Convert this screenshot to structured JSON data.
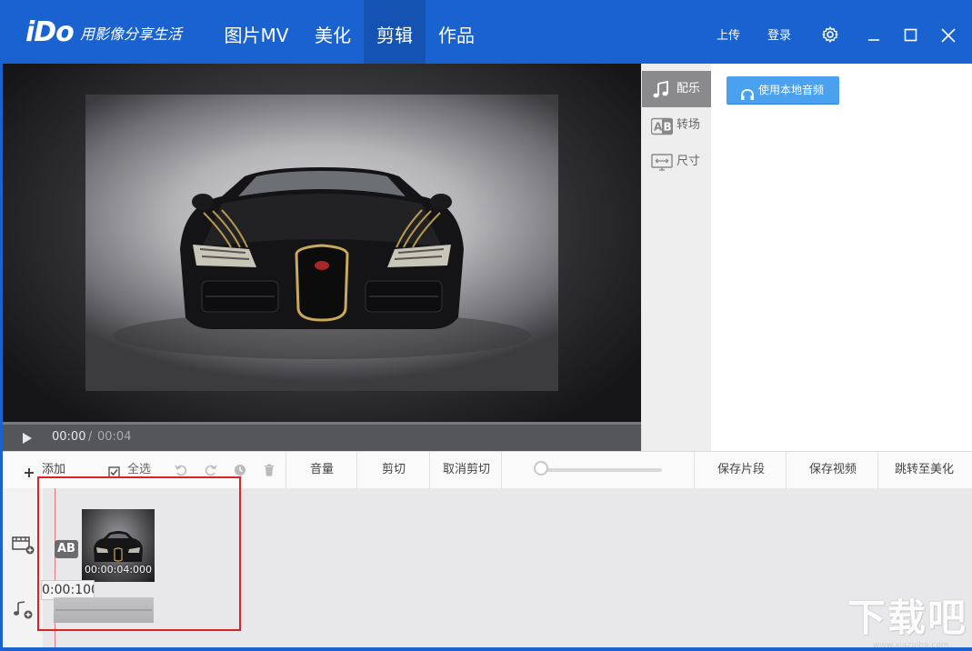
{
  "header": {
    "logo": "iDo",
    "slogan": "用影像分享生活",
    "tabs": [
      {
        "label": "图片MV",
        "active": false
      },
      {
        "label": "美化",
        "active": false
      },
      {
        "label": "剪辑",
        "active": true
      },
      {
        "label": "作品",
        "active": false
      }
    ],
    "upload_label": "上传",
    "login_label": "登录",
    "icons": [
      "gear-icon",
      "minimize-icon",
      "maximize-icon",
      "close-icon"
    ]
  },
  "player": {
    "current_time": "00:00",
    "separator": "/",
    "total_time": "00:04",
    "progress": 0.0
  },
  "side_tabs": [
    {
      "label": "配乐",
      "icon": "music-note-icon",
      "active": true
    },
    {
      "label": "转场",
      "icon": "transition-ab-icon",
      "active": false
    },
    {
      "label": "尺寸",
      "icon": "monitor-size-icon",
      "active": false
    }
  ],
  "music_panel": {
    "local_audio_button": "使用本地音频",
    "icon": "headphones-icon"
  },
  "toolbar": {
    "add_label": "添加",
    "select_all_label": "全选",
    "volume_label": "音量",
    "cut_label": "剪切",
    "cancel_cut_label": "取消剪切",
    "save_segment_label": "保存片段",
    "save_video_label": "保存视频",
    "goto_beautify_label": "跳转至美化",
    "zoom_level": 0.0,
    "icons": [
      "plus-icon",
      "checkbox-icon",
      "undo-icon",
      "redo-icon",
      "clock-icon",
      "trash-icon"
    ]
  },
  "timeline": {
    "transition_badge": "AB",
    "clip_duration": "00:00:04:000",
    "playhead_tooltip": "0:00:100",
    "icons": [
      "add-video-track-icon",
      "add-music-track-icon"
    ]
  },
  "watermark": {
    "text": "下载吧",
    "url": "www.xiazaiba.com"
  },
  "colors": {
    "header_bg": "#1a62cf",
    "active_tab_bg": "#1553b3",
    "accent_button": "#4aa1f0",
    "highlight_red": "#d82428"
  }
}
